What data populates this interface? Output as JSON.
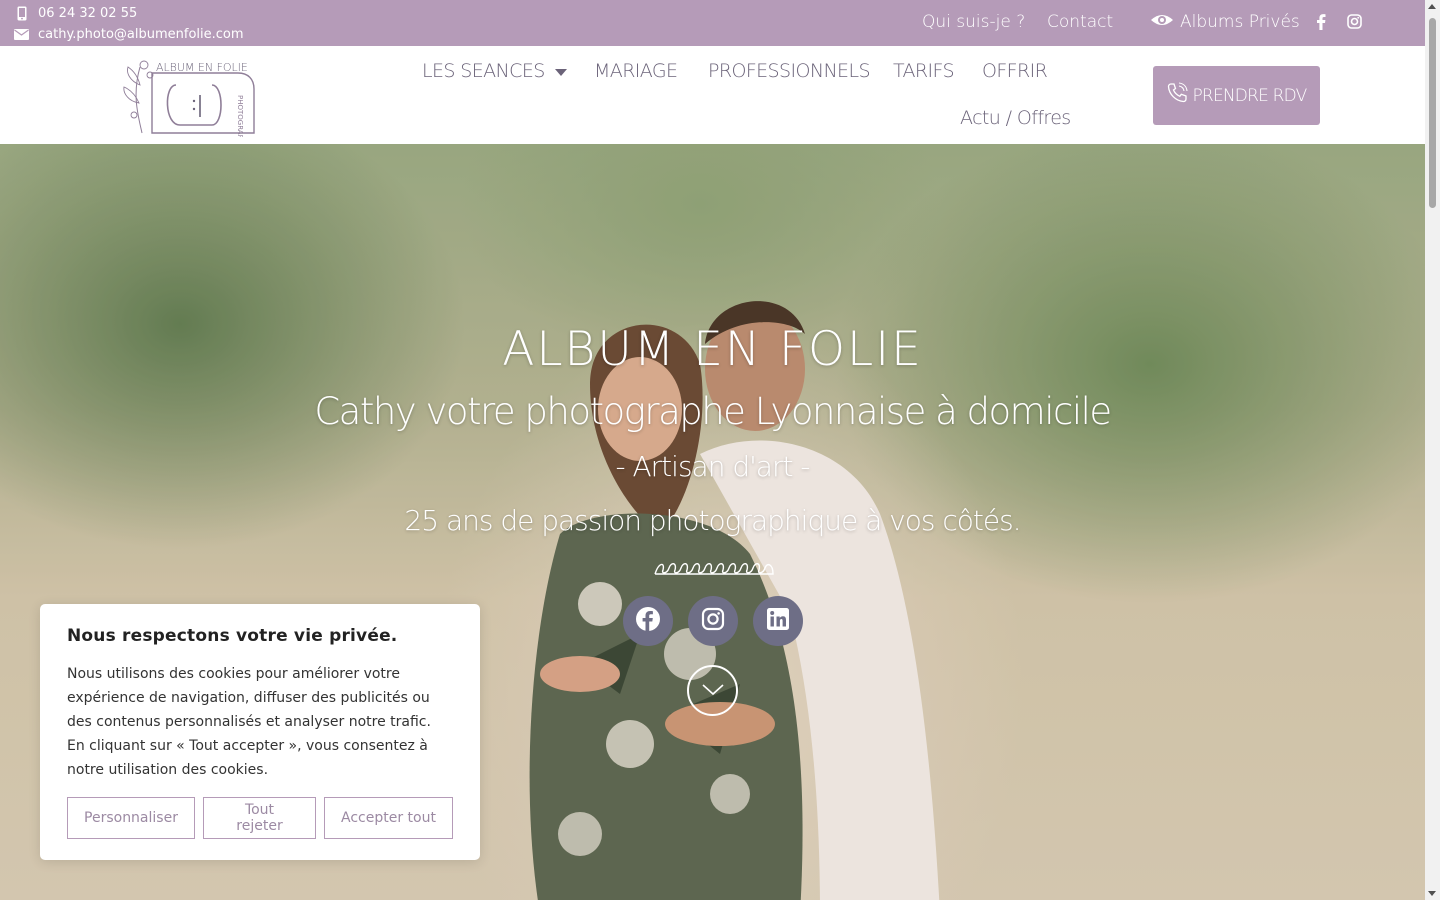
{
  "topbar": {
    "phone": "06 24 32 02 55",
    "email": "cathy.photo@albumenfolie.com",
    "links": {
      "about": "Qui suis-je ?",
      "contact": "Contact",
      "albums": "Albums Privés"
    },
    "icons": {
      "phone": "mobile-phone-icon",
      "email": "envelope-icon",
      "albums": "eye-icon",
      "facebook": "facebook-icon",
      "instagram": "instagram-icon"
    }
  },
  "header": {
    "logo_text": "ALBUM EN FOLIE",
    "logo_side": "PHOTOGRAPHIE",
    "nav": {
      "seances": "LES SEANCES",
      "mariage": "MARIAGE",
      "pro": "PROFESSIONNELS",
      "tarifs": "TARIFS",
      "offrir": "OFFRIR",
      "actu": "Actu / Offres"
    },
    "cta": "PRENDRE RDV"
  },
  "hero": {
    "brand": "ALBUM EN FOLIE",
    "tagline": "Cathy votre photographe Lyonnaise à domicile",
    "artisan": "- Artisan d'art -",
    "passion": "25 ans de passion photographique à vos côtés."
  },
  "cookie": {
    "title": "Nous respectons votre vie privée.",
    "body": "Nous utilisons des cookies pour améliorer votre expérience de navigation, diffuser des publicités ou des contenus personnalisés et analyser notre trafic. En cliquant sur « Tout accepter », vous consentez à notre utilisation des cookies.",
    "customize": "Personnaliser",
    "reject": "Tout rejeter",
    "accept": "Accepter tout"
  },
  "colors": {
    "brand": "#b59bb8",
    "nav_text": "#6b6379",
    "social_bg": "#6e6e86"
  }
}
